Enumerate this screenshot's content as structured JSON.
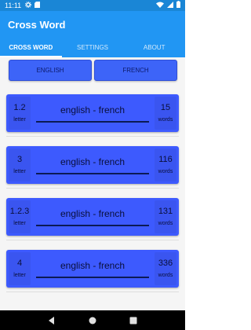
{
  "status_bar": {
    "time": "11:11",
    "icons": [
      "gear-icon",
      "sd-card-icon",
      "wifi-icon",
      "signal-icon",
      "battery-icon"
    ]
  },
  "app_bar": {
    "title": "Cross Word"
  },
  "tabs": [
    {
      "label": "CROSS WORD",
      "active": true
    },
    {
      "label": "SETTINGS",
      "active": false
    },
    {
      "label": "ABOUT",
      "active": false
    }
  ],
  "language_buttons": {
    "left": "ENGLISH",
    "right": "FRENCH"
  },
  "cards": [
    {
      "letters": "1.2",
      "letter_unit": "letter",
      "label": "english - french",
      "words": "15",
      "words_unit": "words"
    },
    {
      "letters": "3",
      "letter_unit": "letter",
      "label": "english - french",
      "words": "116",
      "words_unit": "words"
    },
    {
      "letters": "1.2.3",
      "letter_unit": "letter",
      "label": "english - french",
      "words": "131",
      "words_unit": "words"
    },
    {
      "letters": "4",
      "letter_unit": "letter",
      "label": "english - french",
      "words": "336",
      "words_unit": "words"
    }
  ],
  "nav_bar": {
    "icons": [
      "back-icon",
      "home-icon",
      "recents-icon"
    ]
  },
  "colors": {
    "primary": "#2196f3",
    "status": "#1a86d6",
    "accent": "#3d5afe"
  }
}
